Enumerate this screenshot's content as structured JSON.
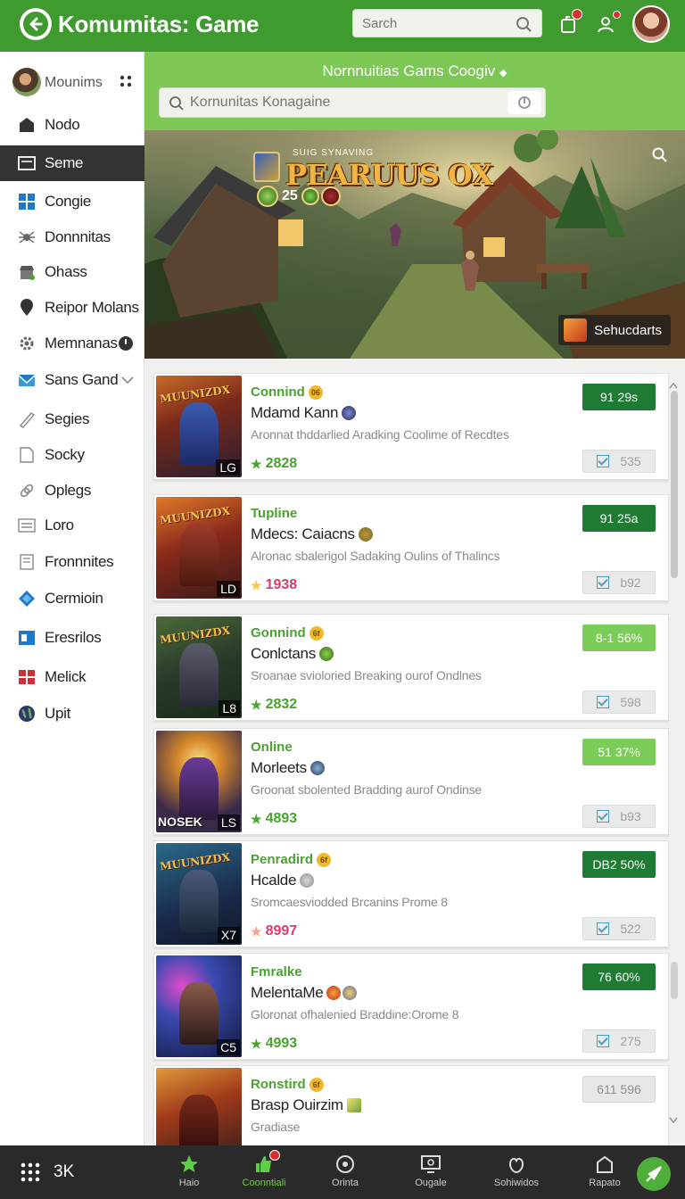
{
  "header": {
    "title": "Komumitas: Game",
    "search_placeholder": "Sarch"
  },
  "sidebar": {
    "user": "Mounims",
    "items": [
      {
        "label": "Nodo",
        "icon": "home-icon"
      },
      {
        "label": "Seme",
        "icon": "screen-icon",
        "active": true
      },
      {
        "label": "Congie",
        "icon": "grid-icon"
      },
      {
        "label": "Donnnitas",
        "icon": "spider-icon"
      },
      {
        "label": "Ohass",
        "icon": "store-icon"
      },
      {
        "label": "Reipor Molans",
        "icon": "pin-icon"
      },
      {
        "label": "Memnanas",
        "icon": "gear-icon"
      },
      {
        "label": "Sans Gand",
        "icon": "mail-icon"
      },
      {
        "label": "Segies",
        "icon": "pen-icon"
      },
      {
        "label": "Socky",
        "icon": "document-icon"
      },
      {
        "label": "Oplegs",
        "icon": "link-icon"
      },
      {
        "label": "Loro",
        "icon": "list-icon"
      },
      {
        "label": "Fronnnites",
        "icon": "page-icon"
      },
      {
        "label": "Cermioin",
        "icon": "diamond-icon"
      },
      {
        "label": "Eresrilos",
        "icon": "window-icon"
      },
      {
        "label": "Melick",
        "icon": "flag-icon"
      },
      {
        "label": "Upit",
        "icon": "globe-icon"
      }
    ]
  },
  "band": {
    "title": "Nornnuitias Gams Coogiv",
    "search_placeholder": "Kornunitas Konagaine"
  },
  "banner": {
    "subtitle": "SUIG SYNAVING",
    "title": "PEARUUS OX",
    "count": "25",
    "button": "Sehucdarts"
  },
  "cards": [
    {
      "title": "Connind",
      "coin": "06",
      "name": "Mdamd Kann",
      "desc": "Aronnat thddarlied Aradking Coolime of Recdtes",
      "score": "2828",
      "badge": "91 29s",
      "badge_color": "#1f7a34",
      "check": "535",
      "thumb": "MUUNIZDX",
      "corner": "LG",
      "score_color": "#4aa22f",
      "star_color": "#4aa22f"
    },
    {
      "title": "Tupline",
      "coin": "",
      "name": "Mdecs: Caiacns",
      "desc": "Alronac sbalerigol Sadaking Oulins of Thalincs",
      "score": "1938",
      "badge": "91 25a",
      "badge_color": "#1f7a34",
      "check": "b92",
      "thumb": "MUUNIZDX",
      "corner": "LD",
      "score_color": "#e23a6a",
      "star_color": "#f3c84b"
    },
    {
      "title": "Gonnind",
      "coin": "6f",
      "name": "Conlctans",
      "desc": "Sroanae svioloried Breaking ourof Ondlnes",
      "score": "2832",
      "badge": "8-1 56%",
      "badge_color": "#7ccc5a",
      "check": "598",
      "thumb": "MUUNIZDX",
      "corner": "L8",
      "score_color": "#4aa22f",
      "star_color": "#4aa22f"
    },
    {
      "title": "Online",
      "coin": "",
      "name": "Morleets",
      "desc": "Groonat sbolented Bradding aurof Ondinse",
      "score": "4893",
      "badge": "51 37%",
      "badge_color": "#7ccc5a",
      "check": "b93",
      "thumb": "NOSEK",
      "corner": "LS",
      "score_color": "#4aa22f",
      "star_color": "#4aa22f"
    },
    {
      "title": "Penradird",
      "coin": "6f",
      "name": "Hcalde",
      "desc": "Sromcaesviodded Brcanins Prome 8",
      "score": "8997",
      "badge": "DB2 50%",
      "badge_color": "#1f7a34",
      "check": "522",
      "thumb": "MUUNIZDX",
      "corner": "X7",
      "score_color": "#e23a6a",
      "star_color": "#f1a487"
    },
    {
      "title": "Fmralke",
      "coin": "",
      "name": "MelentaMe",
      "desc": "Gloronat ofhalenied Braddine:Orome 8",
      "score": "4993",
      "badge": "76 60%",
      "badge_color": "#1f7a34",
      "check": "275",
      "thumb": "",
      "corner": "C5",
      "score_color": "#4aa22f",
      "star_color": "#4aa22f"
    },
    {
      "title": "Ronstird",
      "coin": "6f",
      "name": "Brasp Ouirzim",
      "desc": "Gradiase",
      "score": "",
      "badge": "611 596",
      "badge_color": "#e6e8e5",
      "check": "",
      "thumb": "",
      "corner": "",
      "score_color": "#4aa22f",
      "star_color": "#4aa22f"
    }
  ],
  "bottom": {
    "left_label": "3K",
    "nav": [
      {
        "label": "Haio",
        "icon": "star-icon"
      },
      {
        "label": "Coonntiali",
        "icon": "thumb-icon",
        "active": true
      },
      {
        "label": "Orinta",
        "icon": "target-icon"
      },
      {
        "label": "Ougale",
        "icon": "monitor-icon"
      },
      {
        "label": "Sohiwidos",
        "icon": "hand-icon"
      },
      {
        "label": "Rapato",
        "icon": "house-icon"
      }
    ]
  }
}
